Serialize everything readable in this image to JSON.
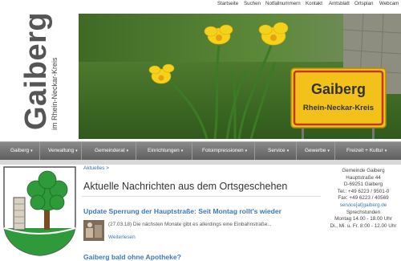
{
  "topnav": [
    "Startseite",
    "Suchen",
    "Notfallnummern",
    "Kontakt",
    "Amtsblatt",
    "Ortsplan",
    "Webcam"
  ],
  "logo": {
    "name": "Gaiberg",
    "subtitle": "im Rhein-Neckar-Kreis"
  },
  "hero": {
    "sign_town": "Gaiberg",
    "sign_district": "Rhein-Neckar-Kreis"
  },
  "mainnav": [
    {
      "label": "Gaiberg"
    },
    {
      "label": "Verwaltung"
    },
    {
      "label": "Gemeinderat"
    },
    {
      "label": "Einrichtungen"
    },
    {
      "label": "Fotoimpressionen"
    },
    {
      "label": "Service"
    },
    {
      "label": "Gewerbe"
    },
    {
      "label": "Freizeit + Kultur"
    }
  ],
  "breadcrumb": "Aktuelles >",
  "page_title": "Aktuelle Nachrichten aus dem Ortsgeschehen",
  "news": [
    {
      "title": "Update Sperrung der Hauptstraße: Seit Montag rollt's wieder",
      "date": "(27.03.18)",
      "teaser": "Die nächsten Monate gibt es allerdings eine Einbahnstraße...",
      "more": "Weiterlesen"
    },
    {
      "title": "Gaiberg bald ohne Apotheke?"
    }
  ],
  "contact": {
    "name": "Gemeinde Gaiberg",
    "street": "Hauptstraße 44",
    "city": "D-69251 Gaiberg",
    "tel": "Tel.: +49 6223 / 9501-0",
    "fax": "Fax: +49 6223 / 40569",
    "email": "service[at]gaiberg.de",
    "hours_title": "Sprechstunden",
    "hours_1": "Montag 14.00 - 18.00 Uhr",
    "hours_2": "Di., Mi. u. Fr. 8:00 - 12.00 Uhr"
  },
  "colors": {
    "link": "#3b79b8",
    "nav_bg": "#6f6f6f",
    "sign_yellow": "#f2c21a",
    "sign_red": "#c0392b"
  },
  "icons": {
    "nav_arrow": "chevron-down-icon"
  }
}
